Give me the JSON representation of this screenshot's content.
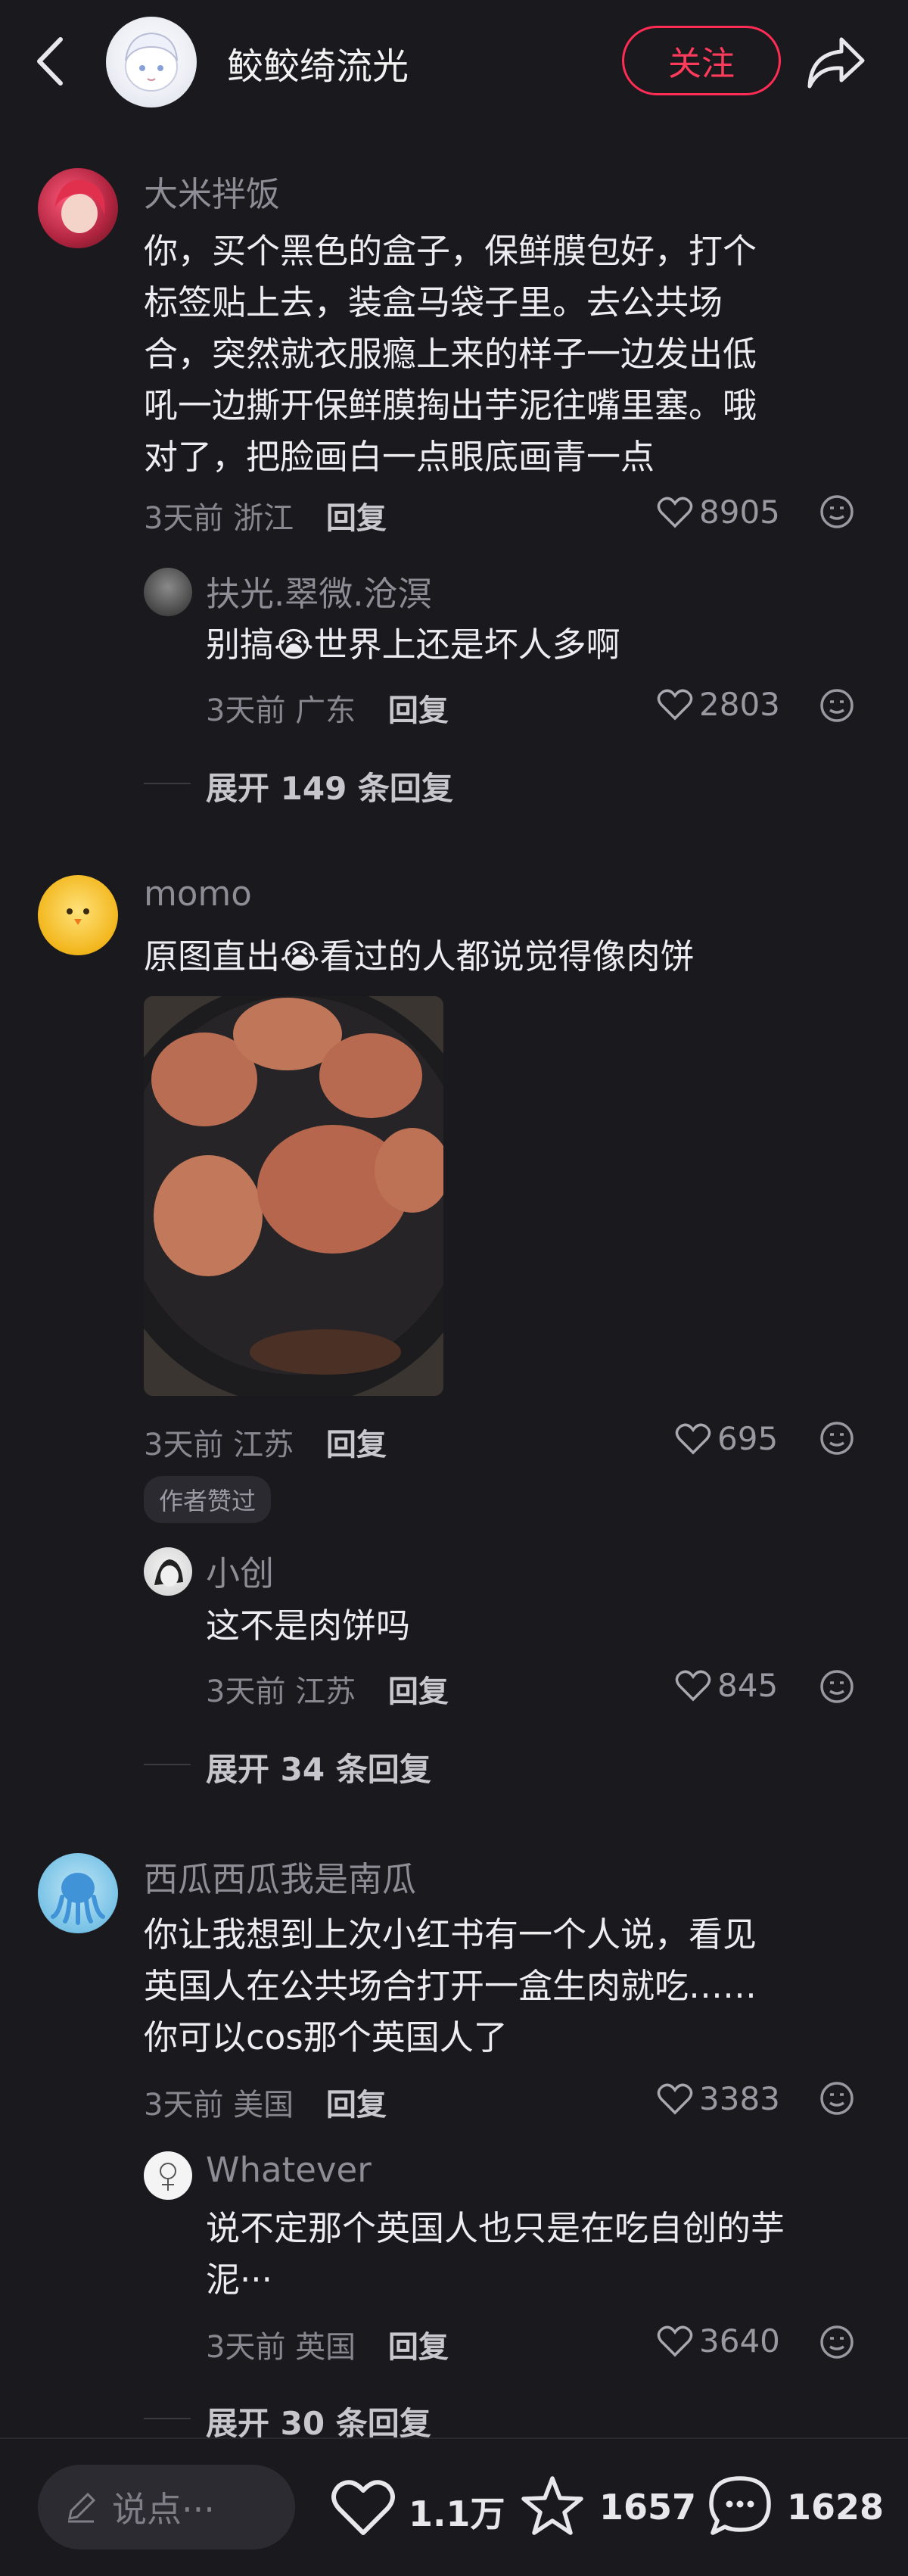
{
  "header": {
    "author_name": "鲛鲛绮流光",
    "follow_label": "关注"
  },
  "comments": [
    {
      "user": "大米拌饭",
      "text_lines": [
        "你，买个黑色的盒子，保鲜膜包好，打个",
        "标签贴上去，装盒马袋子里。去公共场",
        "合，突然就衣服瘾上来的样子一边发出低",
        "吼一边撕开保鲜膜掏出芋泥往嘴里塞。哦",
        "对了，把脸画白一点眼底画青一点"
      ],
      "time": "3天前",
      "location": "浙江",
      "reply_label": "回复",
      "likes": "8905",
      "reply": {
        "user": "扶光.翠微.沧溟",
        "text_before": "别搞",
        "emoji": "😭",
        "text_after": "世界上还是坏人多啊",
        "time": "3天前",
        "location": "广东",
        "reply_label": "回复",
        "likes": "2803"
      },
      "expand_label": "展开 149 条回复"
    },
    {
      "user": "momo",
      "text_before": "原图直出",
      "emoji": "😭",
      "text_after": "看过的人都说觉得像肉饼",
      "time": "3天前",
      "location": "江苏",
      "reply_label": "回复",
      "likes": "695",
      "badge": "作者赞过",
      "reply": {
        "user": "小创",
        "text": "这不是肉饼吗",
        "time": "3天前",
        "location": "江苏",
        "reply_label": "回复",
        "likes": "845"
      },
      "expand_label": "展开 34 条回复"
    },
    {
      "user": "西瓜西瓜我是南瓜",
      "text_lines": [
        "你让我想到上次小红书有一个人说，看见",
        "英国人在公共场合打开一盒生肉就吃……",
        "你可以cos那个英国人了"
      ],
      "time": "3天前",
      "location": "美国",
      "reply_label": "回复",
      "likes": "3383",
      "reply": {
        "user": "Whatever",
        "text_lines": [
          "说不定那个英国人也只是在吃自创的芋",
          "泥···"
        ],
        "time": "3天前",
        "location": "英国",
        "reply_label": "回复",
        "likes": "3640"
      },
      "expand_label": "展开 30 条回复"
    }
  ],
  "bottom_bar": {
    "input_placeholder": "说点···",
    "likes": "1.1万",
    "favorites": "1657",
    "comments": "1628"
  },
  "colors": {
    "background": "#1a191e",
    "accent": "#ff2d55"
  }
}
